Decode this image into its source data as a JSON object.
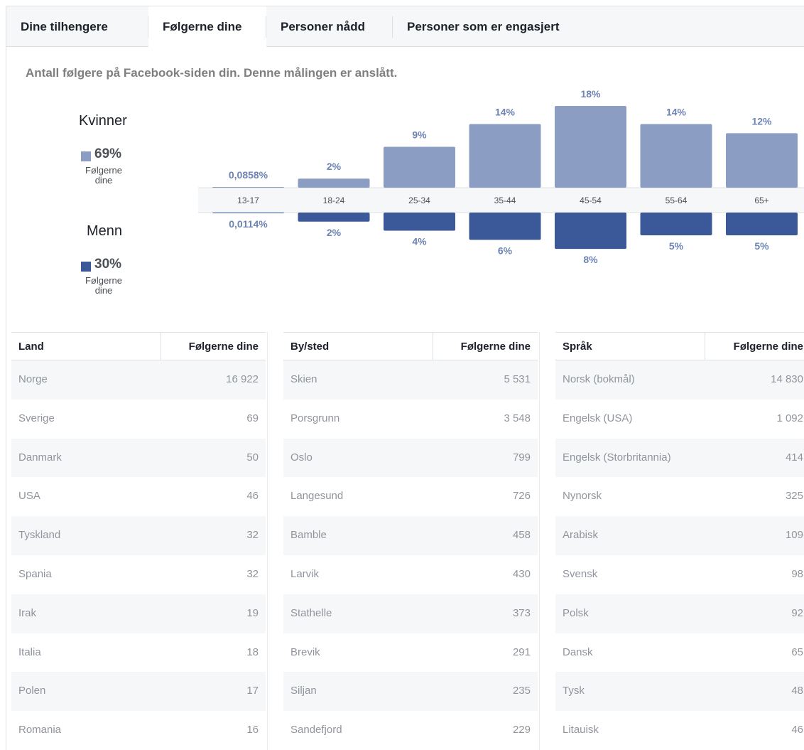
{
  "tabs": [
    {
      "label": "Dine tilhengere"
    },
    {
      "label": "Følgerne dine"
    },
    {
      "label": "Personer nådd"
    },
    {
      "label": "Personer som er engasjert"
    }
  ],
  "subtitle": "Antall følgere på Facebook-siden din. Denne målingen er anslått.",
  "legend": {
    "women": {
      "label": "Kvinner",
      "pct": "69%",
      "sub_line1": "Følgerne",
      "sub_line2": "dine",
      "color": "#8b9dc3"
    },
    "men": {
      "label": "Menn",
      "pct": "30%",
      "sub_line1": "Følgerne",
      "sub_line2": "dine",
      "color": "#3b5998"
    }
  },
  "chart_data": {
    "type": "bar",
    "categories": [
      "13-17",
      "18-24",
      "25-34",
      "35-44",
      "45-54",
      "55-64",
      "65+"
    ],
    "series": [
      {
        "name": "Kvinner",
        "values": [
          0.0858,
          2,
          9,
          14,
          18,
          14,
          12
        ],
        "labels": [
          "0,0858%",
          "2%",
          "9%",
          "14%",
          "18%",
          "14%",
          "12%"
        ],
        "color": "#8b9dc3"
      },
      {
        "name": "Menn",
        "values": [
          0.0114,
          2,
          4,
          6,
          8,
          5,
          5
        ],
        "labels": [
          "0,0114%",
          "2%",
          "4%",
          "6%",
          "8%",
          "5%",
          "5%"
        ],
        "color": "#3b5998"
      }
    ],
    "unit": "%",
    "ylim": [
      0,
      18
    ],
    "legend": "left"
  },
  "tables": [
    {
      "headers": [
        "Land",
        "Følgerne dine"
      ],
      "rows": [
        [
          "Norge",
          "16 922"
        ],
        [
          "Sverige",
          "69"
        ],
        [
          "Danmark",
          "50"
        ],
        [
          "USA",
          "46"
        ],
        [
          "Tyskland",
          "32"
        ],
        [
          "Spania",
          "32"
        ],
        [
          "Irak",
          "19"
        ],
        [
          "Italia",
          "18"
        ],
        [
          "Polen",
          "17"
        ],
        [
          "Romania",
          "16"
        ]
      ]
    },
    {
      "headers": [
        "By/sted",
        "Følgerne dine"
      ],
      "rows": [
        [
          "Skien",
          "5 531"
        ],
        [
          "Porsgrunn",
          "3 548"
        ],
        [
          "Oslo",
          "799"
        ],
        [
          "Langesund",
          "726"
        ],
        [
          "Bamble",
          "458"
        ],
        [
          "Larvik",
          "430"
        ],
        [
          "Stathelle",
          "373"
        ],
        [
          "Brevik",
          "291"
        ],
        [
          "Siljan",
          "235"
        ],
        [
          "Sandefjord",
          "229"
        ]
      ]
    },
    {
      "headers": [
        "Språk",
        "Følgerne dine"
      ],
      "rows": [
        [
          "Norsk (bokmål)",
          "14 830"
        ],
        [
          "Engelsk (USA)",
          "1 092"
        ],
        [
          "Engelsk (Storbritannia)",
          "414"
        ],
        [
          "Nynorsk",
          "325"
        ],
        [
          "Arabisk",
          "109"
        ],
        [
          "Svensk",
          "98"
        ],
        [
          "Polsk",
          "92"
        ],
        [
          "Dansk",
          "65"
        ],
        [
          "Tysk",
          "48"
        ],
        [
          "Litauisk",
          "46"
        ]
      ]
    }
  ]
}
